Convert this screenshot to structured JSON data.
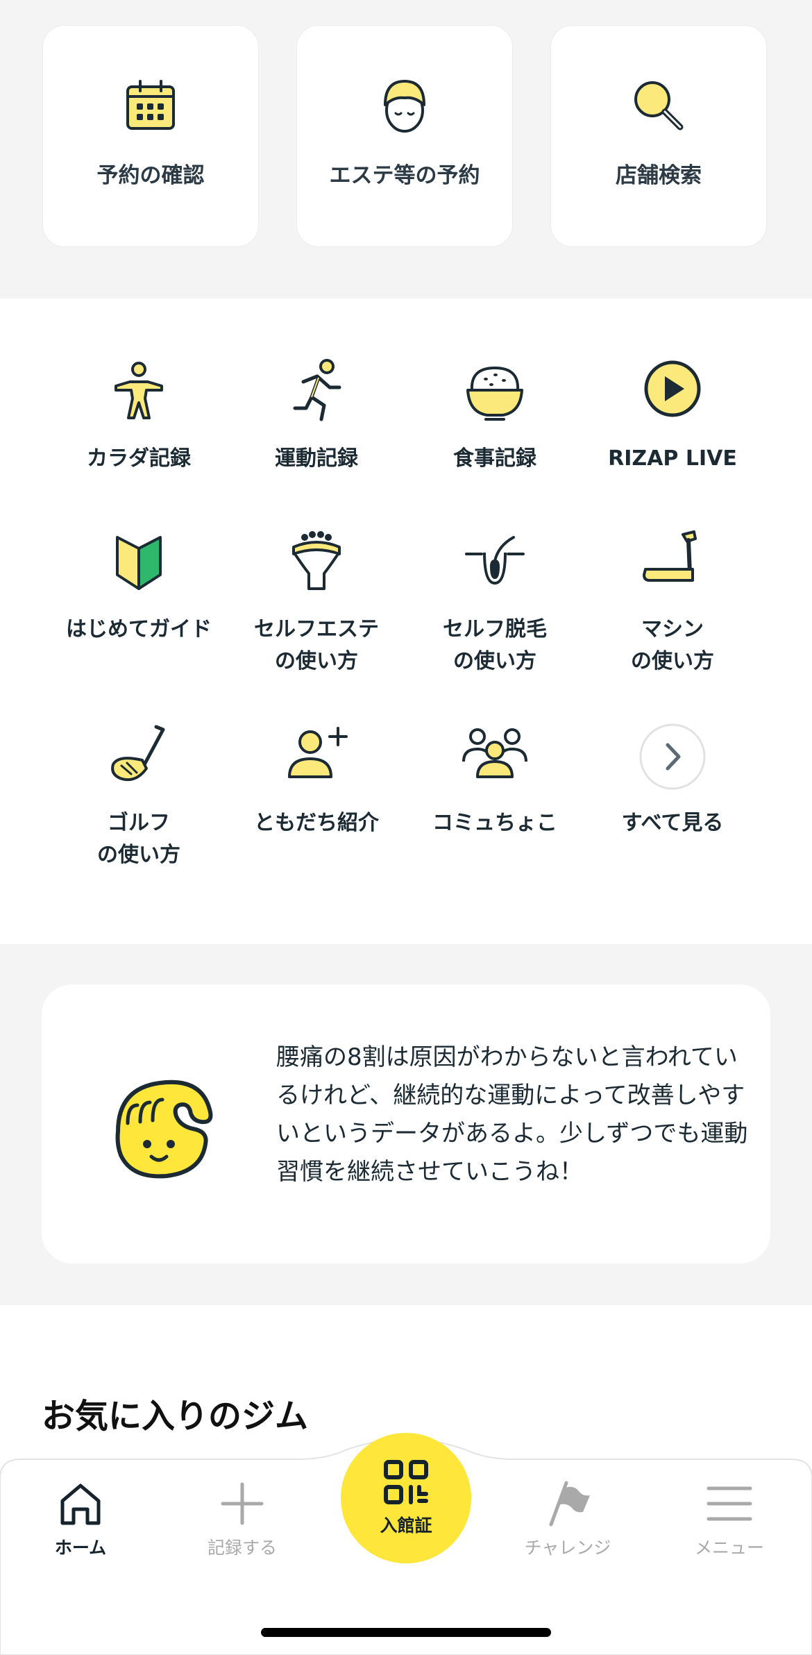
{
  "colors": {
    "accent_yellow": "#ffe63a",
    "icon_yellow": "#fbe97c",
    "ink": "#1b2a33",
    "bg_gray": "#f4f4f4",
    "inactive": "#a9a9a9"
  },
  "quick_actions": [
    {
      "label": "予約の確認",
      "icon": "calendar-icon"
    },
    {
      "label": "エステ等の予約",
      "icon": "face-towel-icon"
    },
    {
      "label": "店舗検索",
      "icon": "search-icon"
    }
  ],
  "menu": [
    {
      "label": "カラダ記録",
      "icon": "body-icon"
    },
    {
      "label": "運動記録",
      "icon": "running-icon"
    },
    {
      "label": "食事記録",
      "icon": "rice-bowl-icon"
    },
    {
      "label": "RIZAP LIVE",
      "icon": "play-icon"
    },
    {
      "label": "はじめてガイド",
      "icon": "beginner-mark-icon"
    },
    {
      "label": "セルフエステ\nの使い方",
      "icon": "esthe-device-icon"
    },
    {
      "label": "セルフ脱毛\nの使い方",
      "icon": "hair-removal-icon"
    },
    {
      "label": "マシン\nの使い方",
      "icon": "treadmill-icon"
    },
    {
      "label": "ゴルフ\nの使い方",
      "icon": "golf-club-icon"
    },
    {
      "label": "ともだち紹介",
      "icon": "add-friend-icon"
    },
    {
      "label": "コミュちょこ",
      "icon": "community-icon"
    },
    {
      "label": "すべて見る",
      "icon": "chevron-right-icon"
    }
  ],
  "tip": {
    "text": "腰痛の8割は原因がわからないと言われているけれど、継続的な運動によって改善しやすいというデータがあるよ。少しずつでも運動習慣を継続させていこうね！",
    "mascot": "mascot-icon"
  },
  "favorites": {
    "title": "お気に入りのジム"
  },
  "nav": {
    "home": "ホーム",
    "record": "記録する",
    "checkin": "入館証",
    "challenge": "チャレンジ",
    "menu": "メニュー"
  }
}
